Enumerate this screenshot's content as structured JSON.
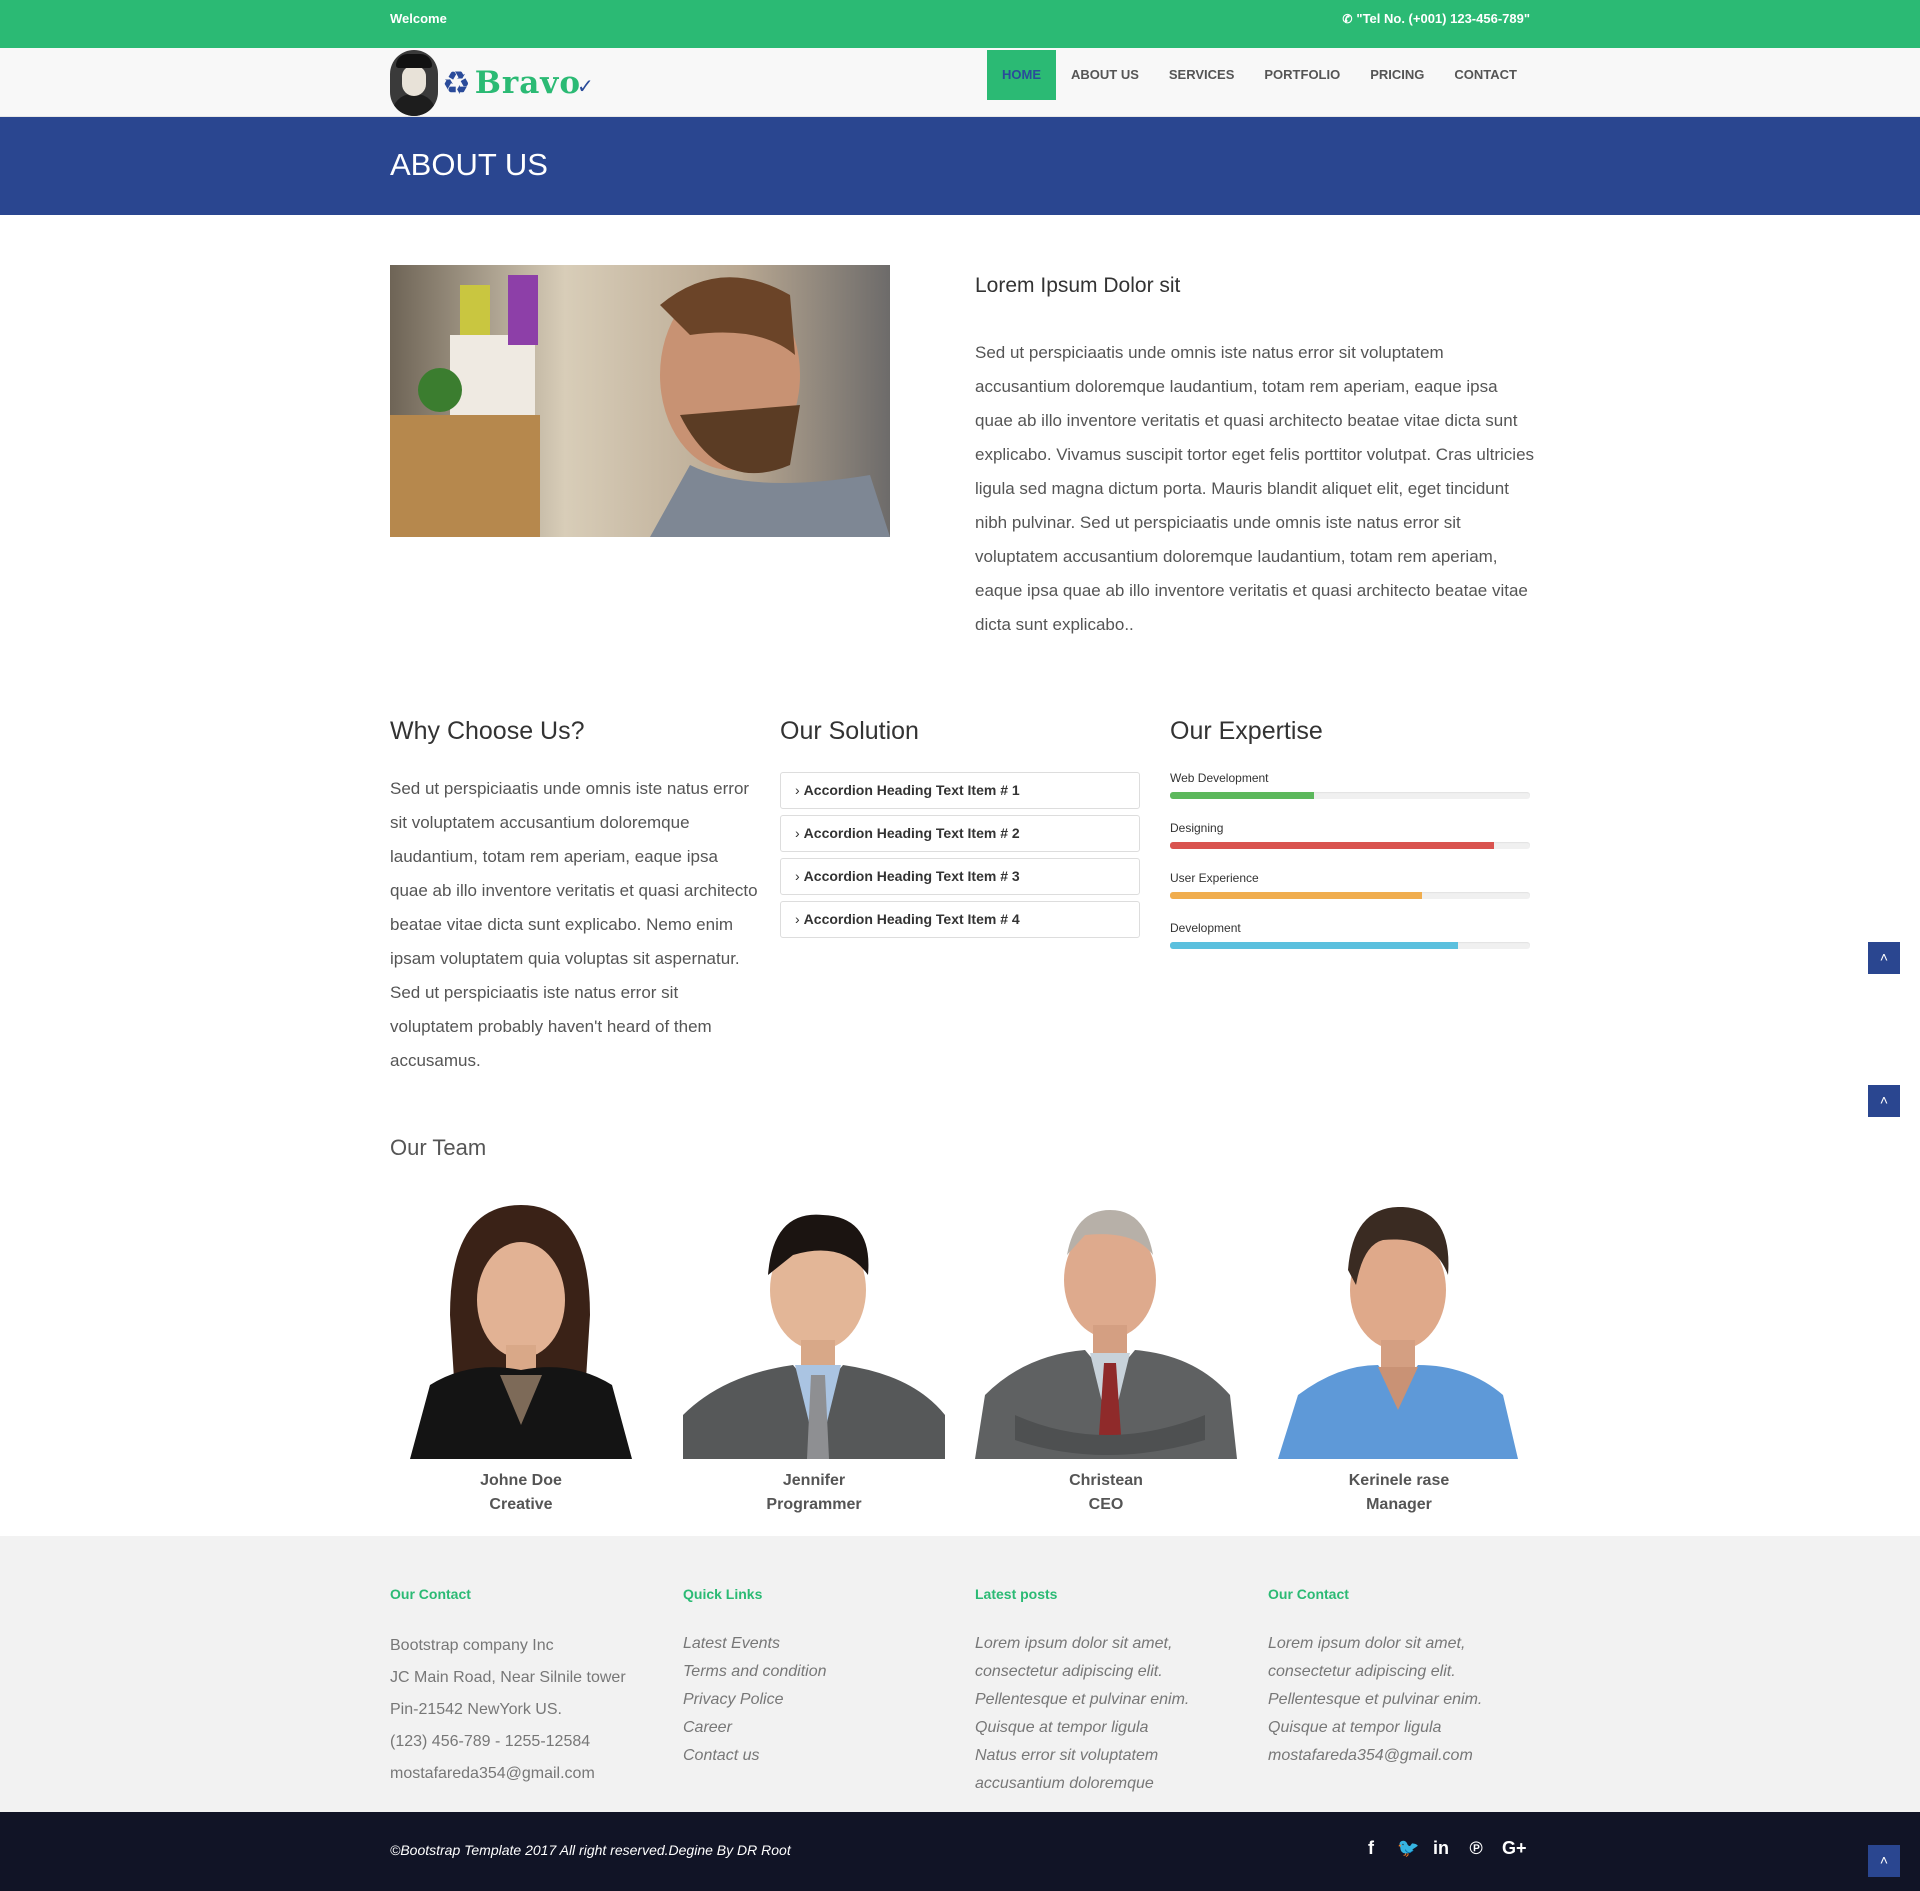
{
  "topbar": {
    "welcome": "Welcome",
    "phone": "\"Tel No. (+001) 123-456-789\"",
    "phone_icon": "phone-icon"
  },
  "brand": {
    "name": "Bravo"
  },
  "nav": {
    "items": [
      {
        "label": "HOME",
        "active": true
      },
      {
        "label": "ABOUT US"
      },
      {
        "label": "SERVICES"
      },
      {
        "label": "PORTFOLIO"
      },
      {
        "label": "PRICING"
      },
      {
        "label": "CONTACT"
      }
    ]
  },
  "banner": {
    "title": "ABOUT US"
  },
  "about": {
    "title": "Lorem Ipsum Dolor sit",
    "text": "Sed ut perspiciaatis unde omnis iste natus error sit voluptatem accusantium doloremque laudantium, totam rem aperiam, eaque ipsa quae ab illo inventore veritatis et quasi architecto beatae vitae dicta sunt explicabo. Vivamus suscipit tortor eget felis porttitor volutpat. Cras ultricies ligula sed magna dictum porta. Mauris blandit aliquet elit, eget tincidunt nibh pulvinar. Sed ut perspiciaatis unde omnis iste natus error sit voluptatem accusantium doloremque laudantium, totam rem aperiam, eaque ipsa quae ab illo inventore veritatis et quasi architecto beatae vitae dicta sunt explicabo.."
  },
  "why": {
    "title": "Why Choose Us?",
    "text": "Sed ut perspiciaatis unde omnis iste natus error sit voluptatem accusantium doloremque laudantium, totam rem aperiam, eaque ipsa quae ab illo inventore veritatis et quasi architecto beatae vitae dicta sunt explicabo. Nemo enim ipsam voluptatem quia voluptas sit aspernatur. Sed ut perspiciaatis iste natus error sit voluptatem probably haven't heard of them accusamus."
  },
  "solution": {
    "title": "Our Solution",
    "items": [
      "Accordion Heading Text Item # 1",
      "Accordion Heading Text Item # 2",
      "Accordion Heading Text Item # 3",
      "Accordion Heading Text Item # 4"
    ]
  },
  "expertise": {
    "title": "Our Expertise",
    "skills": [
      {
        "label": "Web Development",
        "percent": 40,
        "color": "#5cb85c"
      },
      {
        "label": "Designing",
        "percent": 90,
        "color": "#d9534f"
      },
      {
        "label": "User Experience",
        "percent": 70,
        "color": "#f0ad4e"
      },
      {
        "label": "Development",
        "percent": 80,
        "color": "#5bc0de"
      }
    ]
  },
  "team": {
    "title": "Our Team",
    "members": [
      {
        "name": "Johne Doe",
        "role": "Creative"
      },
      {
        "name": "Jennifer",
        "role": "Programmer"
      },
      {
        "name": "Christean",
        "role": "CEO"
      },
      {
        "name": "Kerinele rase",
        "role": "Manager"
      }
    ]
  },
  "footer": {
    "contact": {
      "title": "Our Contact",
      "lines": [
        "Bootstrap company Inc",
        "JC Main Road, Near Silnile tower",
        "Pin-21542 NewYork US.",
        "(123) 456-789 - 1255-12584",
        "mostafareda354@gmail.com"
      ]
    },
    "links": {
      "title": "Quick Links",
      "items": [
        "Latest Events",
        "Terms and condition",
        "Privacy Police",
        "Career",
        "Contact us"
      ]
    },
    "posts": {
      "title": "Latest posts",
      "lines": [
        "Lorem ipsum dolor sit amet,",
        "consectetur adipiscing elit.",
        "Pellentesque et pulvinar enim.",
        "Quisque at tempor ligula",
        "Natus error sit voluptatem",
        "accusantium doloremque"
      ]
    },
    "contact2": {
      "title": "Our Contact",
      "lines": [
        "Lorem ipsum dolor sit amet,",
        "consectetur adipiscing elit.",
        "Pellentesque et pulvinar enim.",
        "Quisque at tempor ligula",
        "mostafareda354@gmail.com"
      ]
    }
  },
  "bottom": {
    "copyright": "©Bootstrap Template 2017 All right reserved.Degine By DR Root",
    "social": [
      {
        "icon": "facebook-icon",
        "glyph": "f"
      },
      {
        "icon": "twitter-icon",
        "glyph": "🐦"
      },
      {
        "icon": "linkedin-icon",
        "glyph": "in"
      },
      {
        "icon": "pinterest-icon",
        "glyph": "℗"
      },
      {
        "icon": "google-plus-icon",
        "glyph": "G+"
      }
    ]
  },
  "scroll_top_glyph": "˄"
}
